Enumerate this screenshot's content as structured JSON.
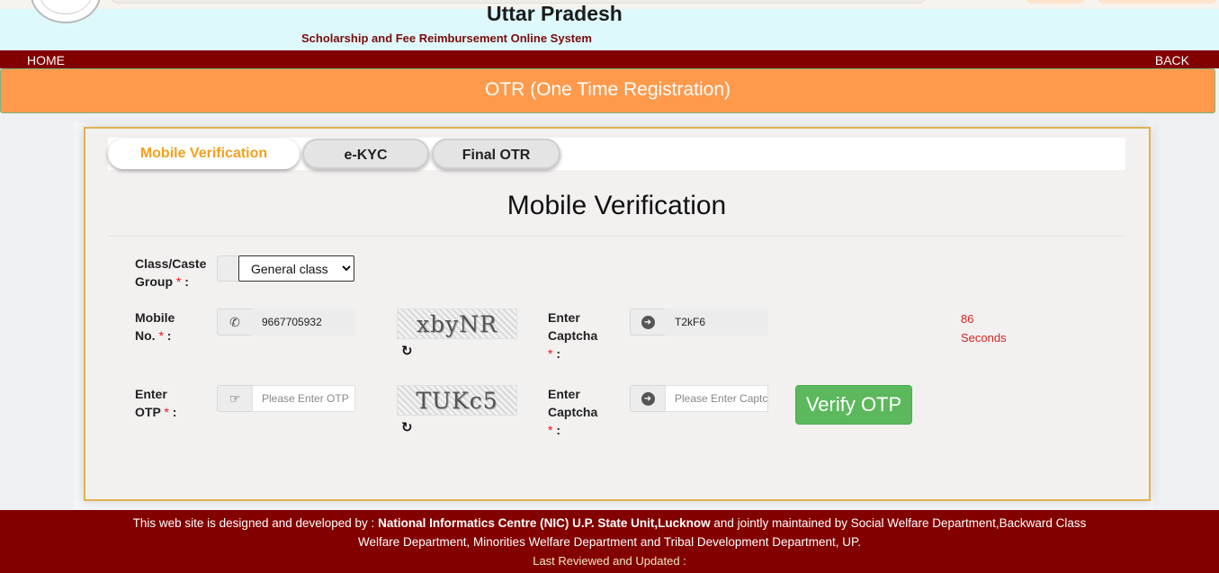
{
  "header": {
    "state_title": "Uttar Pradesh",
    "subtitle": "Scholarship and Fee Reimbursement Online System"
  },
  "nav": {
    "home": "HOME",
    "back": "BACK"
  },
  "banner": {
    "title": "OTR (One Time Registration)"
  },
  "tabs": [
    {
      "label": "Mobile Verification",
      "active": true
    },
    {
      "label": "e-KYC",
      "active": false
    },
    {
      "label": "Final OTR",
      "active": false
    }
  ],
  "form": {
    "title": "Mobile Verification",
    "class_group": {
      "label": "Class/Caste Group",
      "value": "General class"
    },
    "mobile": {
      "label": "Mobile No.",
      "value": "9667705932"
    },
    "captcha1": {
      "image_text": "xbyNR",
      "label": "Enter Captcha",
      "value": "T2kF6"
    },
    "otp": {
      "label": "Enter OTP",
      "placeholder": "Please Enter OTP"
    },
    "captcha2": {
      "image_text": "TUKc5",
      "label": "Enter Captcha",
      "placeholder": "Please Enter Captcha"
    },
    "timer": {
      "value": "86",
      "unit": "Seconds"
    },
    "required_mark": "*",
    "verify_button": "Verify OTP"
  },
  "footer": {
    "line1_prefix": "This web site is designed and developed by :",
    "line1_org": "National Informatics Centre (NIC) U.P. State Unit,Lucknow",
    "line1_suffix": "and jointly maintained by Social Welfare Department,Backward Class",
    "line2": "Welfare Department, Minorities Welfare Department and Tribal Development Department, UP.",
    "line3": "Last Reviewed and Updated :"
  },
  "icons": {
    "phone": "phone-icon",
    "hand": "hand-point-icon",
    "arrow": "arrow-circle-right-icon",
    "refresh": "refresh-icon"
  },
  "colors": {
    "nav_bg": "#830000",
    "banner_bg": "#ff9a4d",
    "active_tab_text": "#f1a11f",
    "verify_button": "#5cb85c",
    "timer_text": "#d02525"
  }
}
